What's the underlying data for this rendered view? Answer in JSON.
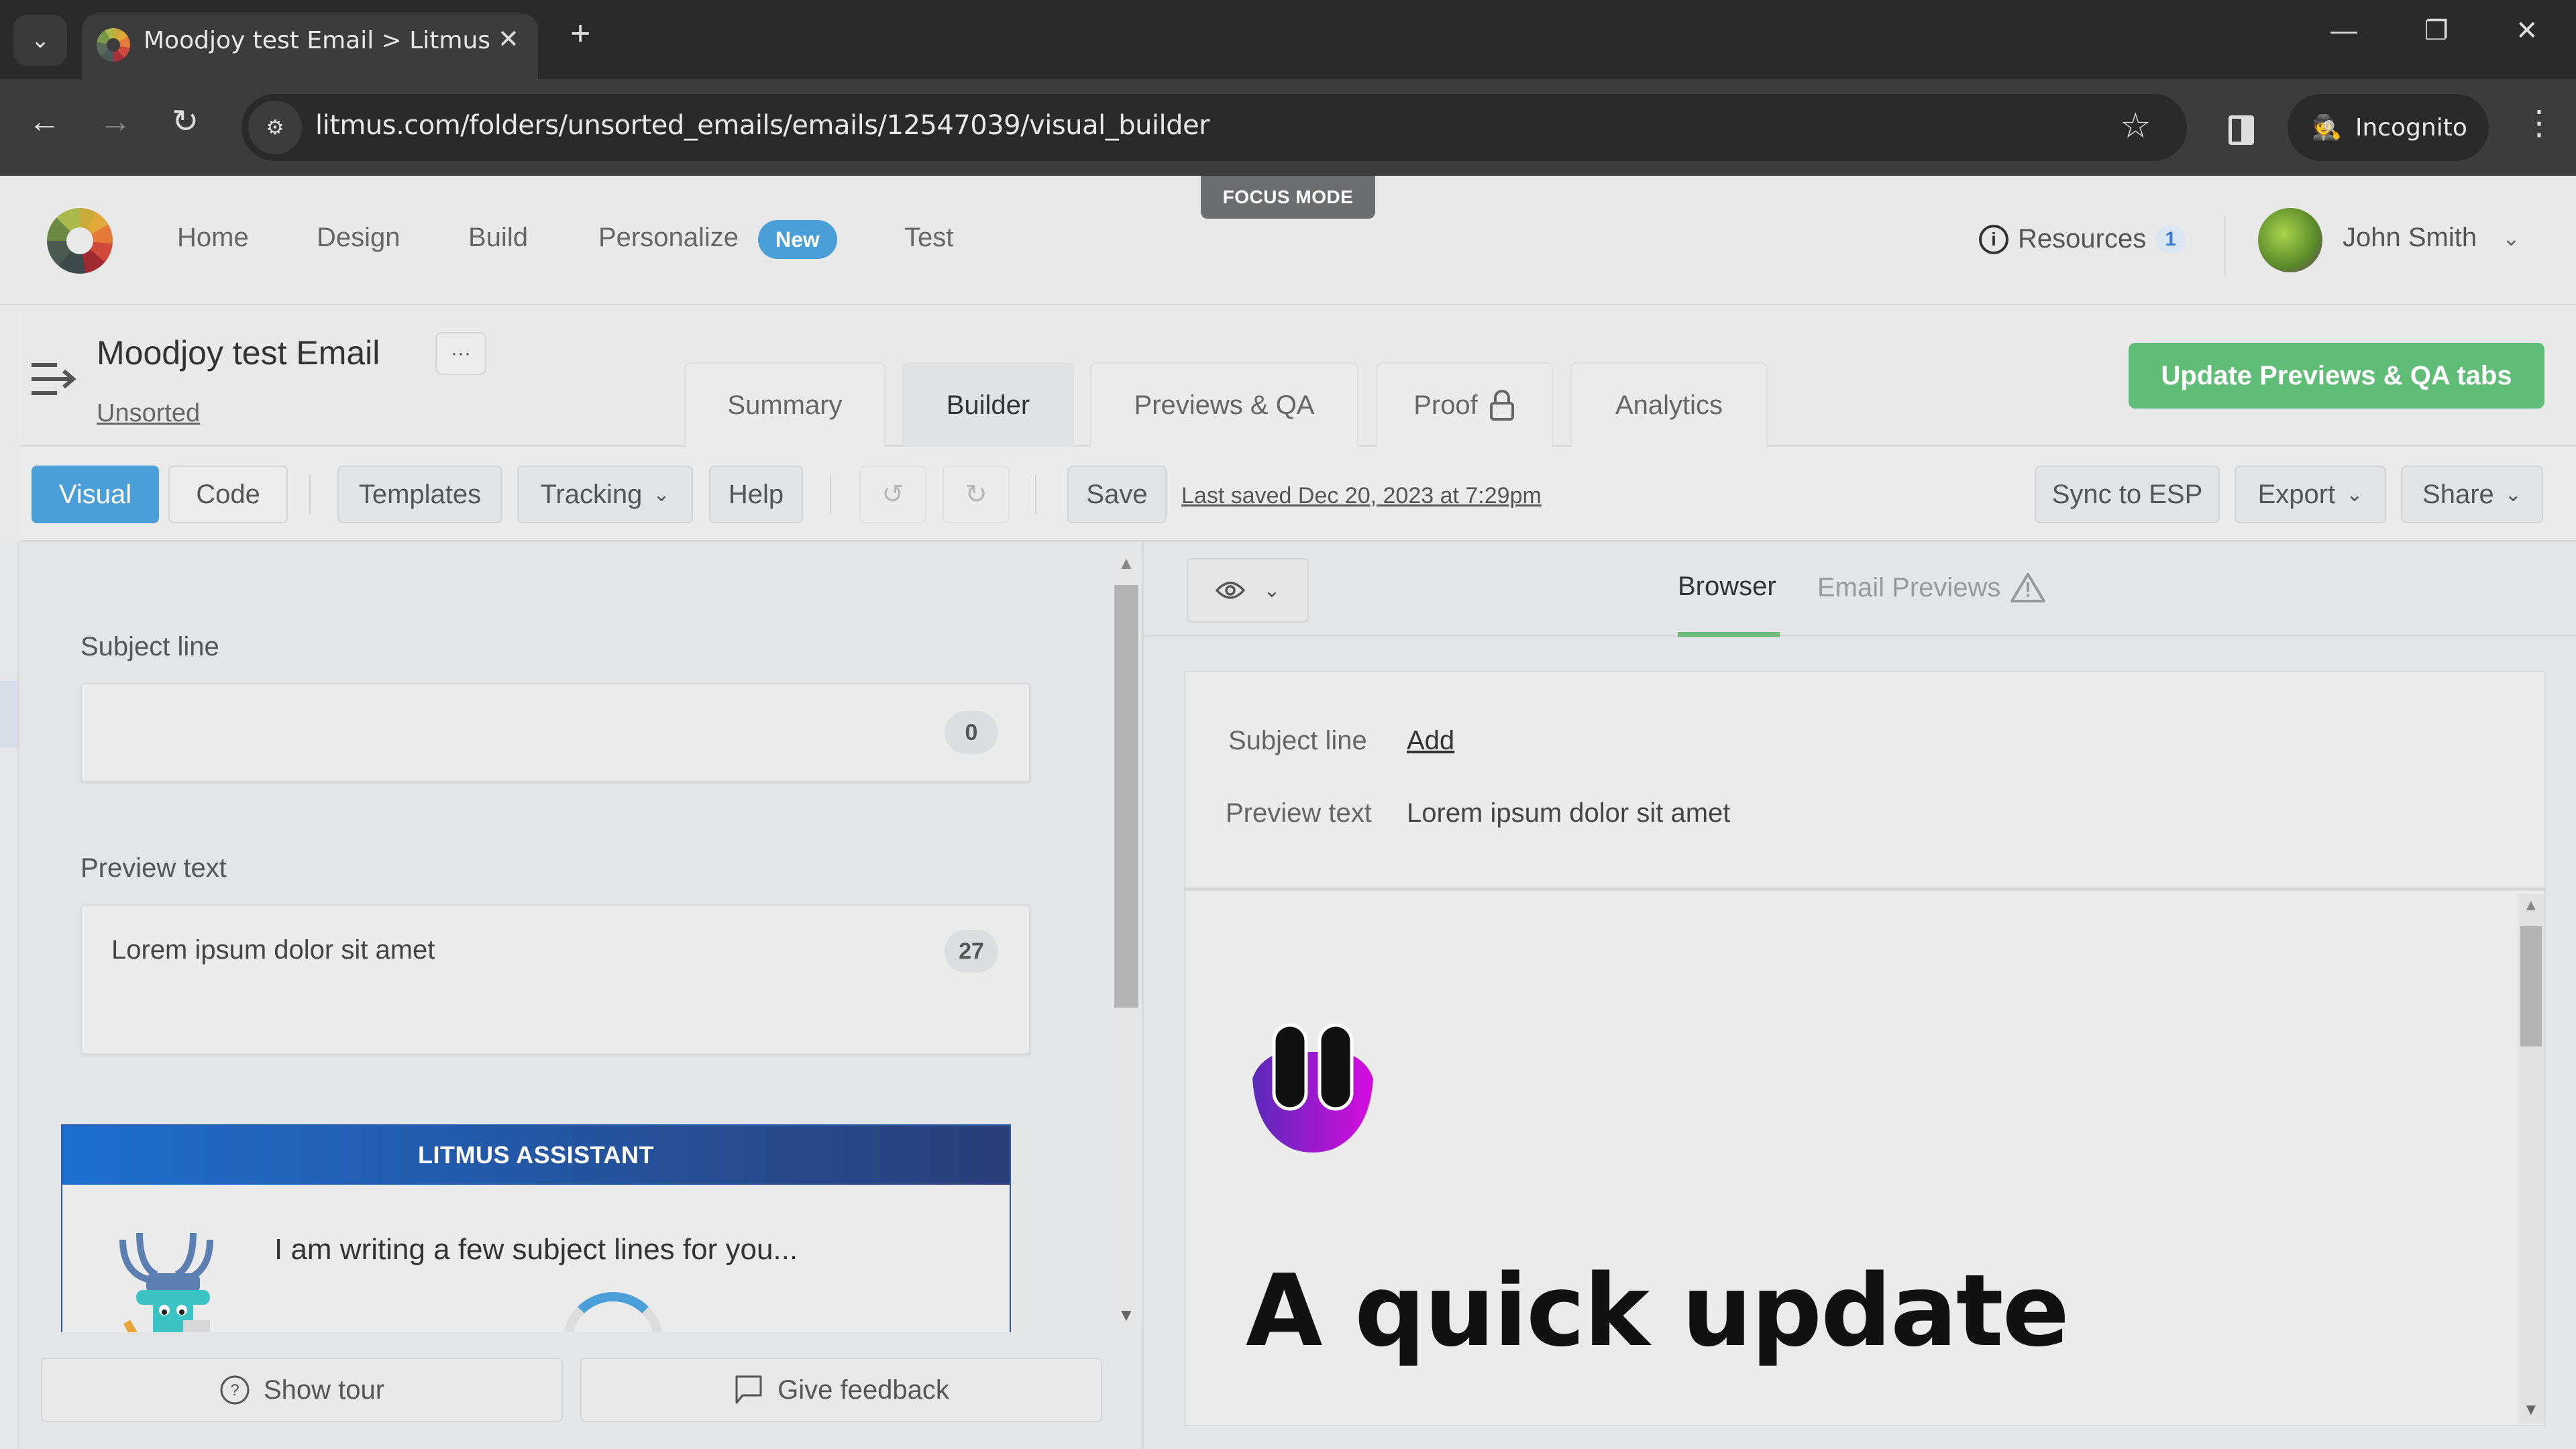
{
  "browser": {
    "tab_title": "Moodjoy test Email > Litmus",
    "tab_close": "✕",
    "new_tab": "+",
    "tab_list": "⌄",
    "url": "litmus.com/folders/unsorted_emails/emails/12547039/visual_builder",
    "incognito_label": "Incognito",
    "window_controls": {
      "minimize": "—",
      "restore": "❐",
      "close": "✕"
    },
    "nav": {
      "back": "←",
      "forward": "→",
      "reload": "↻"
    },
    "star": "☆",
    "menu": "⋮"
  },
  "app_header": {
    "nav_items": [
      "Home",
      "Design",
      "Build",
      "Personalize",
      "Test"
    ],
    "new_badge": "New",
    "focus_mode": "FOCUS MODE",
    "resources_label": "Resources",
    "resources_count": "1",
    "user_name": "John Smith"
  },
  "email": {
    "title": "Moodjoy test Email",
    "more": "···",
    "folder": "Unsorted"
  },
  "page_tabs": [
    {
      "label": "Summary",
      "active": false
    },
    {
      "label": "Builder",
      "active": true
    },
    {
      "label": "Previews & QA",
      "active": false
    },
    {
      "label": "Proof",
      "active": false,
      "locked": true
    },
    {
      "label": "Analytics",
      "active": false
    }
  ],
  "update_button": "Update Previews & QA tabs",
  "toolbar": {
    "visual": "Visual",
    "code": "Code",
    "templates": "Templates",
    "tracking": "Tracking",
    "help": "Help",
    "save": "Save",
    "last_saved": "Last saved Dec 20, 2023 at 7:29pm",
    "sync": "Sync to ESP",
    "export": "Export",
    "share": "Share"
  },
  "editor": {
    "subject_label": "Subject line",
    "subject_value": "",
    "subject_count": "0",
    "preview_label": "Preview text",
    "preview_value": "Lorem ipsum dolor sit amet",
    "preview_count": "27",
    "assistant_title": "LITMUS ASSISTANT",
    "assistant_message": "I am writing a few subject lines for you..."
  },
  "bottom": {
    "show_tour": "Show tour",
    "give_feedback": "Give feedback"
  },
  "preview": {
    "tabs": [
      {
        "label": "Browser",
        "active": true
      },
      {
        "label": "Email Previews",
        "active": false,
        "warning": true
      }
    ],
    "subject_label": "Subject line",
    "subject_action": "Add",
    "preview_label": "Preview text",
    "preview_value": "Lorem ipsum dolor sit amet",
    "heading": "A quick update"
  },
  "colors": {
    "primary_blue": "#4a9fd8",
    "update_green": "#5fbd77",
    "active_tab_underline": "#6fba7c",
    "assistant_gradient_start": "#1d6fd0",
    "assistant_gradient_end": "#2a3e78"
  }
}
